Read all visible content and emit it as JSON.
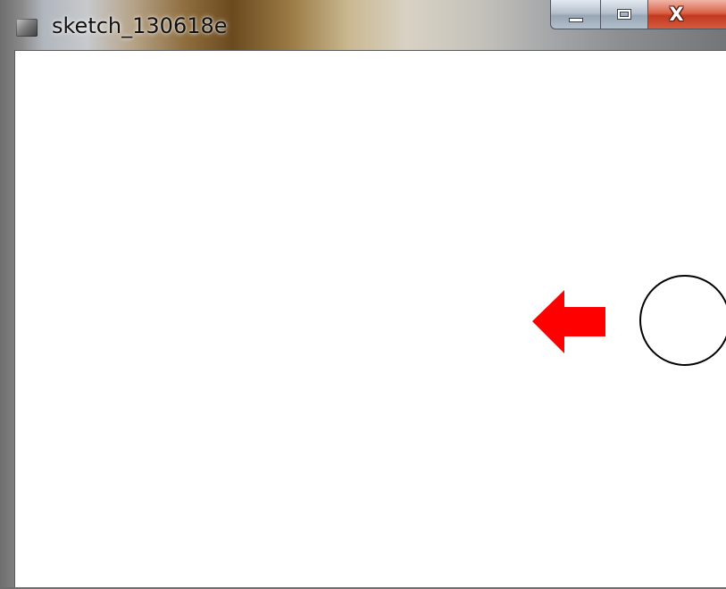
{
  "window": {
    "title": "sketch_130618e",
    "icon": "processing-sketch-icon",
    "controls": {
      "minimize_icon": "minimize-icon",
      "maximize_icon": "maximize-icon",
      "close_label": "X"
    }
  },
  "canvas": {
    "background": "#ffffff",
    "shapes": [
      {
        "type": "circle",
        "stroke": "#000000",
        "fill": "none"
      },
      {
        "type": "arrow",
        "direction": "left",
        "color": "#ff0000"
      }
    ]
  }
}
